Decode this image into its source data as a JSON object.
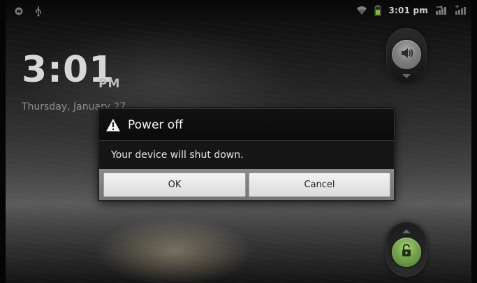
{
  "status_bar": {
    "left_icons": [
      "android-notification-icon",
      "usb-icon"
    ],
    "right_icons": [
      "wifi-icon",
      "battery-icon",
      "signal-icon-1",
      "signal-icon-2"
    ],
    "time": "3:01 pm"
  },
  "lock_screen": {
    "time": "3:01",
    "ampm": "PM",
    "date": "Thursday, January 27"
  },
  "dialog": {
    "title": "Power off",
    "message": "Your device will shut down.",
    "buttons": {
      "ok": "OK",
      "cancel": "Cancel"
    }
  },
  "controls": {
    "top_slider_icon": "volume-icon",
    "bottom_slider_icon": "unlock-icon"
  }
}
